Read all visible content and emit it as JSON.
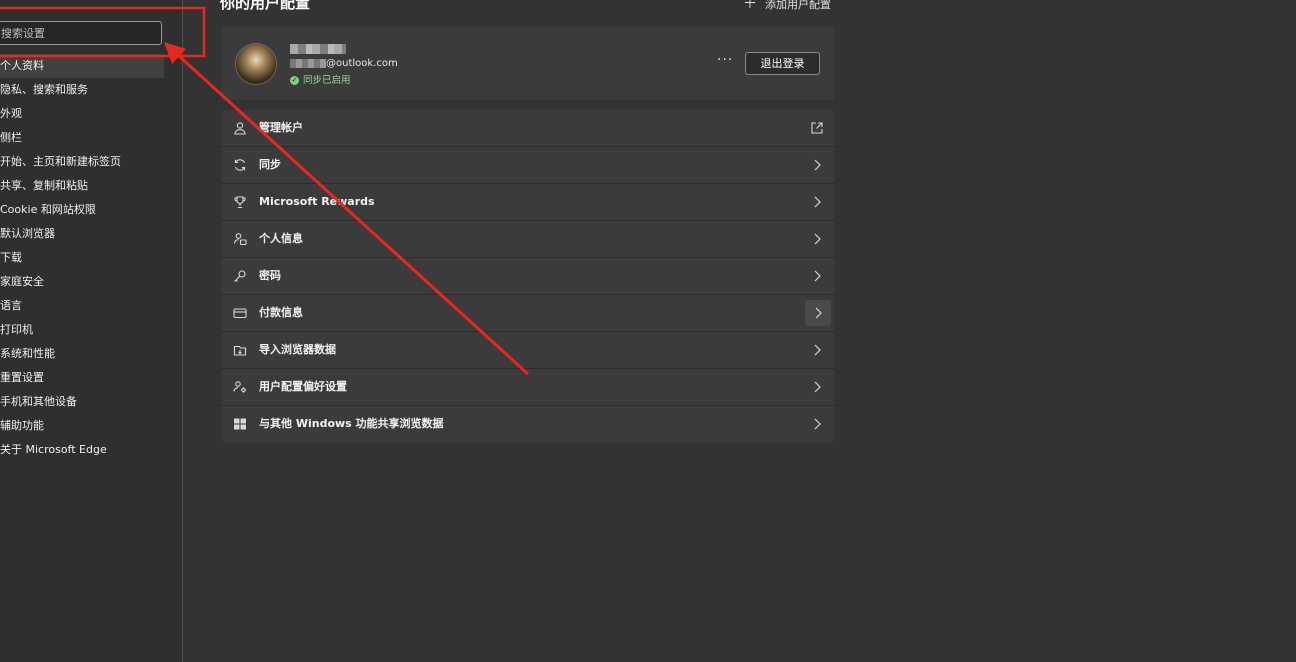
{
  "sidebar": {
    "search_placeholder": "搜索设置",
    "items": [
      {
        "label": "个人资料"
      },
      {
        "label": "隐私、搜索和服务"
      },
      {
        "label": "外观"
      },
      {
        "label": "侧栏"
      },
      {
        "label": "开始、主页和新建标签页"
      },
      {
        "label": "共享、复制和粘贴"
      },
      {
        "label": "Cookie 和网站权限"
      },
      {
        "label": "默认浏览器"
      },
      {
        "label": "下载"
      },
      {
        "label": "家庭安全"
      },
      {
        "label": "语言"
      },
      {
        "label": "打印机"
      },
      {
        "label": "系统和性能"
      },
      {
        "label": "重置设置"
      },
      {
        "label": "手机和其他设备"
      },
      {
        "label": "辅助功能"
      },
      {
        "label": "关于 Microsoft Edge"
      }
    ]
  },
  "header": {
    "title": "你的用户配置",
    "add_profile_label": "添加用户配置"
  },
  "profile": {
    "email_suffix": "@outlook.com",
    "sync_status": "同步已启用",
    "more_label": "···",
    "signout_label": "退出登录"
  },
  "rows": [
    {
      "label": "管理帐户",
      "icon": "person-icon",
      "action": "external-link-icon"
    },
    {
      "label": "同步",
      "icon": "sync-icon",
      "action": "chevron-right-icon"
    },
    {
      "label": "Microsoft Rewards",
      "icon": "trophy-icon",
      "action": "chevron-right-icon"
    },
    {
      "label": "个人信息",
      "icon": "person-card-icon",
      "action": "chevron-right-icon"
    },
    {
      "label": "密码",
      "icon": "key-icon",
      "action": "chevron-right-icon"
    },
    {
      "label": "付款信息",
      "icon": "credit-card-icon",
      "action": "chevron-right-icon"
    },
    {
      "label": "导入浏览器数据",
      "icon": "import-icon",
      "action": "chevron-right-icon"
    },
    {
      "label": "用户配置偏好设置",
      "icon": "people-settings-icon",
      "action": "chevron-right-icon"
    },
    {
      "label": "与其他 Windows 功能共享浏览数据",
      "icon": "windows-icon",
      "action": "chevron-right-icon"
    }
  ],
  "colors": {
    "background": "#333333",
    "card": "#3b3b3b",
    "sync_green": "#7fd07a",
    "annotation_red": "#e8271e"
  }
}
